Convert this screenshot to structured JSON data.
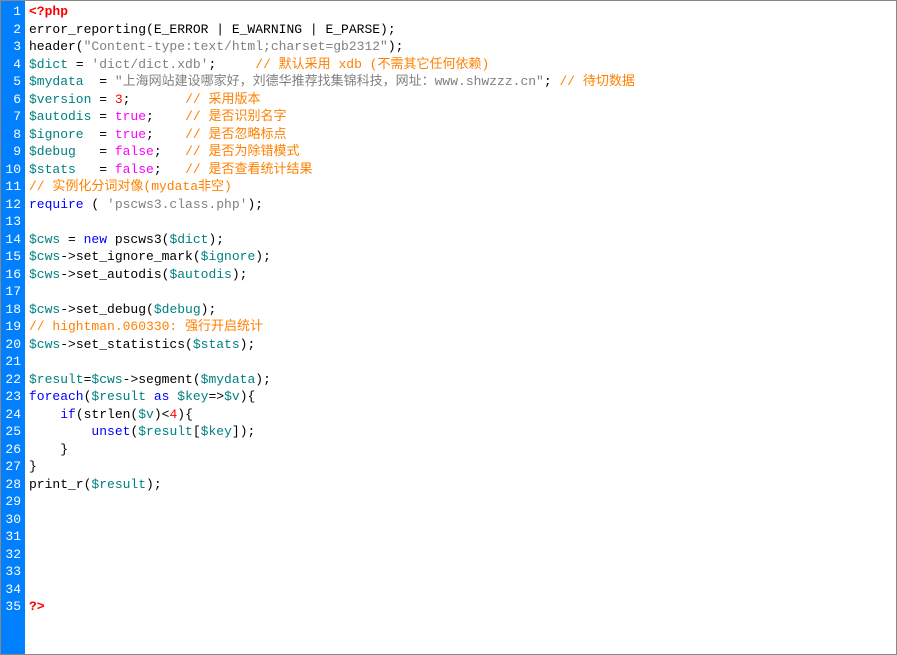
{
  "lines": [
    {
      "n": "1",
      "segs": [
        {
          "c": "tag",
          "t": "<?php"
        }
      ]
    },
    {
      "n": "2",
      "segs": [
        {
          "c": "func",
          "t": "error_reporting(E_ERROR | E_WARNING | E_PARSE);"
        }
      ]
    },
    {
      "n": "3",
      "segs": [
        {
          "c": "func",
          "t": "header("
        },
        {
          "c": "str",
          "t": "\"Content-type:text/html;charset=gb2312\""
        },
        {
          "c": "func",
          "t": ");"
        }
      ]
    },
    {
      "n": "4",
      "segs": [
        {
          "c": "var",
          "t": "$dict"
        },
        {
          "c": "func",
          "t": " = "
        },
        {
          "c": "str",
          "t": "'dict/dict.xdb'"
        },
        {
          "c": "func",
          "t": ";     "
        },
        {
          "c": "cmt",
          "t": "// 默认采用 xdb (不需其它任何依赖)"
        }
      ]
    },
    {
      "n": "5",
      "segs": [
        {
          "c": "var",
          "t": "$mydata"
        },
        {
          "c": "func",
          "t": "  = "
        },
        {
          "c": "str",
          "t": "\"上海网站建设哪家好，刘德华推荐找集锦科技，网址：www.shwzzz.cn\""
        },
        {
          "c": "func",
          "t": "; "
        },
        {
          "c": "cmt",
          "t": "// 待切数据"
        }
      ]
    },
    {
      "n": "6",
      "segs": [
        {
          "c": "var",
          "t": "$version"
        },
        {
          "c": "func",
          "t": " = "
        },
        {
          "c": "num",
          "t": "3"
        },
        {
          "c": "func",
          "t": ";       "
        },
        {
          "c": "cmt",
          "t": "// 采用版本"
        }
      ]
    },
    {
      "n": "7",
      "segs": [
        {
          "c": "var",
          "t": "$autodis"
        },
        {
          "c": "func",
          "t": " = "
        },
        {
          "c": "bool",
          "t": "true"
        },
        {
          "c": "func",
          "t": ";    "
        },
        {
          "c": "cmt",
          "t": "// 是否识别名字"
        }
      ]
    },
    {
      "n": "8",
      "segs": [
        {
          "c": "var",
          "t": "$ignore"
        },
        {
          "c": "func",
          "t": "  = "
        },
        {
          "c": "bool",
          "t": "true"
        },
        {
          "c": "func",
          "t": ";    "
        },
        {
          "c": "cmt",
          "t": "// 是否忽略标点"
        }
      ]
    },
    {
      "n": "9",
      "segs": [
        {
          "c": "var",
          "t": "$debug"
        },
        {
          "c": "func",
          "t": "   = "
        },
        {
          "c": "bool",
          "t": "false"
        },
        {
          "c": "func",
          "t": ";   "
        },
        {
          "c": "cmt",
          "t": "// 是否为除错模式"
        }
      ]
    },
    {
      "n": "10",
      "segs": [
        {
          "c": "var",
          "t": "$stats"
        },
        {
          "c": "func",
          "t": "   = "
        },
        {
          "c": "bool",
          "t": "false"
        },
        {
          "c": "func",
          "t": ";   "
        },
        {
          "c": "cmt",
          "t": "// 是否查看统计结果"
        }
      ]
    },
    {
      "n": "11",
      "segs": [
        {
          "c": "cmt",
          "t": "// 实例化分词对像(mydata非空)"
        }
      ]
    },
    {
      "n": "12",
      "segs": [
        {
          "c": "kw",
          "t": "require"
        },
        {
          "c": "func",
          "t": " ( "
        },
        {
          "c": "str",
          "t": "'pscws3.class.php'"
        },
        {
          "c": "func",
          "t": ");"
        }
      ]
    },
    {
      "n": "13",
      "segs": [
        {
          "c": "func",
          "t": " "
        }
      ]
    },
    {
      "n": "14",
      "segs": [
        {
          "c": "var",
          "t": "$cws"
        },
        {
          "c": "func",
          "t": " = "
        },
        {
          "c": "kw",
          "t": "new"
        },
        {
          "c": "func",
          "t": " pscws3("
        },
        {
          "c": "var",
          "t": "$dict"
        },
        {
          "c": "func",
          "t": ");"
        }
      ]
    },
    {
      "n": "15",
      "segs": [
        {
          "c": "var",
          "t": "$cws"
        },
        {
          "c": "func",
          "t": "->set_ignore_mark("
        },
        {
          "c": "var",
          "t": "$ignore"
        },
        {
          "c": "func",
          "t": ");"
        }
      ]
    },
    {
      "n": "16",
      "segs": [
        {
          "c": "var",
          "t": "$cws"
        },
        {
          "c": "func",
          "t": "->set_autodis("
        },
        {
          "c": "var",
          "t": "$autodis"
        },
        {
          "c": "func",
          "t": ");"
        }
      ]
    },
    {
      "n": "17",
      "segs": [
        {
          "c": "func",
          "t": " "
        }
      ]
    },
    {
      "n": "18",
      "segs": [
        {
          "c": "var",
          "t": "$cws"
        },
        {
          "c": "func",
          "t": "->set_debug("
        },
        {
          "c": "var",
          "t": "$debug"
        },
        {
          "c": "func",
          "t": ");"
        }
      ]
    },
    {
      "n": "19",
      "segs": [
        {
          "c": "cmt",
          "t": "// hightman.060330: 强行开启统计"
        }
      ]
    },
    {
      "n": "20",
      "segs": [
        {
          "c": "var",
          "t": "$cws"
        },
        {
          "c": "func",
          "t": "->set_statistics("
        },
        {
          "c": "var",
          "t": "$stats"
        },
        {
          "c": "func",
          "t": ");"
        }
      ]
    },
    {
      "n": "21",
      "segs": [
        {
          "c": "func",
          "t": " "
        }
      ]
    },
    {
      "n": "22",
      "segs": [
        {
          "c": "var",
          "t": "$result"
        },
        {
          "c": "func",
          "t": "="
        },
        {
          "c": "var",
          "t": "$cws"
        },
        {
          "c": "func",
          "t": "->segment("
        },
        {
          "c": "var",
          "t": "$mydata"
        },
        {
          "c": "func",
          "t": ");"
        }
      ]
    },
    {
      "n": "23",
      "segs": [
        {
          "c": "kw",
          "t": "foreach"
        },
        {
          "c": "func",
          "t": "("
        },
        {
          "c": "var",
          "t": "$result"
        },
        {
          "c": "func",
          "t": " "
        },
        {
          "c": "kw",
          "t": "as"
        },
        {
          "c": "func",
          "t": " "
        },
        {
          "c": "var",
          "t": "$key"
        },
        {
          "c": "func",
          "t": "=>"
        },
        {
          "c": "var",
          "t": "$v"
        },
        {
          "c": "func",
          "t": "){"
        }
      ]
    },
    {
      "n": "24",
      "segs": [
        {
          "c": "func",
          "t": "    "
        },
        {
          "c": "kw",
          "t": "if"
        },
        {
          "c": "func",
          "t": "(strlen("
        },
        {
          "c": "var",
          "t": "$v"
        },
        {
          "c": "func",
          "t": ")<"
        },
        {
          "c": "num",
          "t": "4"
        },
        {
          "c": "func",
          "t": "){"
        }
      ]
    },
    {
      "n": "25",
      "segs": [
        {
          "c": "func",
          "t": "        "
        },
        {
          "c": "kw",
          "t": "unset"
        },
        {
          "c": "func",
          "t": "("
        },
        {
          "c": "var",
          "t": "$result"
        },
        {
          "c": "func",
          "t": "["
        },
        {
          "c": "var",
          "t": "$key"
        },
        {
          "c": "func",
          "t": "]);"
        }
      ]
    },
    {
      "n": "26",
      "segs": [
        {
          "c": "func",
          "t": "    }"
        }
      ]
    },
    {
      "n": "27",
      "segs": [
        {
          "c": "func",
          "t": "}"
        }
      ]
    },
    {
      "n": "28",
      "segs": [
        {
          "c": "func",
          "t": "print_r("
        },
        {
          "c": "var",
          "t": "$result"
        },
        {
          "c": "func",
          "t": ");"
        }
      ]
    },
    {
      "n": "29",
      "segs": [
        {
          "c": "func",
          "t": " "
        }
      ]
    },
    {
      "n": "30",
      "segs": [
        {
          "c": "func",
          "t": " "
        }
      ]
    },
    {
      "n": "31",
      "segs": [
        {
          "c": "func",
          "t": " "
        }
      ]
    },
    {
      "n": "32",
      "segs": [
        {
          "c": "func",
          "t": " "
        }
      ]
    },
    {
      "n": "33",
      "segs": [
        {
          "c": "func",
          "t": " "
        }
      ]
    },
    {
      "n": "34",
      "segs": [
        {
          "c": "func",
          "t": " "
        }
      ]
    },
    {
      "n": "35",
      "segs": [
        {
          "c": "tag",
          "t": "?>"
        }
      ]
    }
  ]
}
